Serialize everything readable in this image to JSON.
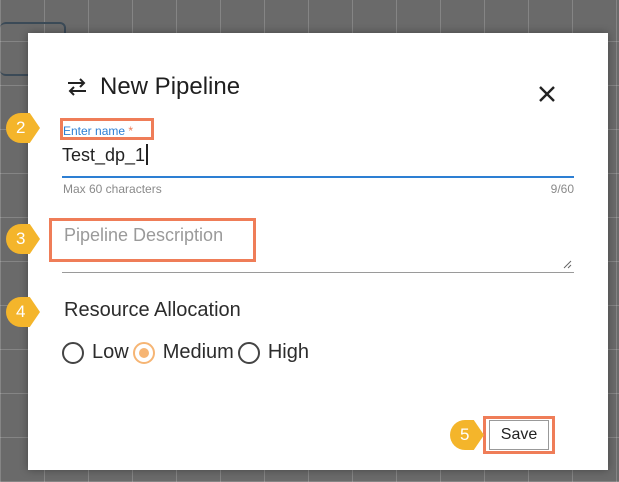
{
  "dialog": {
    "title": "New Pipeline",
    "title_icon": "swap-arrows-icon",
    "close_icon": "close-icon"
  },
  "name_field": {
    "label": "Enter name",
    "required_mark": "*",
    "value": "Test_dp_1",
    "hint": "Max 60 characters",
    "counter": "9/60"
  },
  "description_field": {
    "placeholder": "Pipeline Description",
    "value": ""
  },
  "resource_allocation": {
    "label": "Resource Allocation",
    "options": [
      {
        "label": "Low",
        "checked": false
      },
      {
        "label": "Medium",
        "checked": true
      },
      {
        "label": "High",
        "checked": false
      }
    ]
  },
  "actions": {
    "save_label": "Save"
  },
  "callouts": {
    "name": "2",
    "description": "3",
    "resource": "4",
    "save": "5"
  },
  "colors": {
    "accent_blue": "#2d7fd3",
    "highlight_border": "#ef7d58",
    "callout_yellow": "#f4b52b",
    "radio_checked": "#f6b574"
  }
}
